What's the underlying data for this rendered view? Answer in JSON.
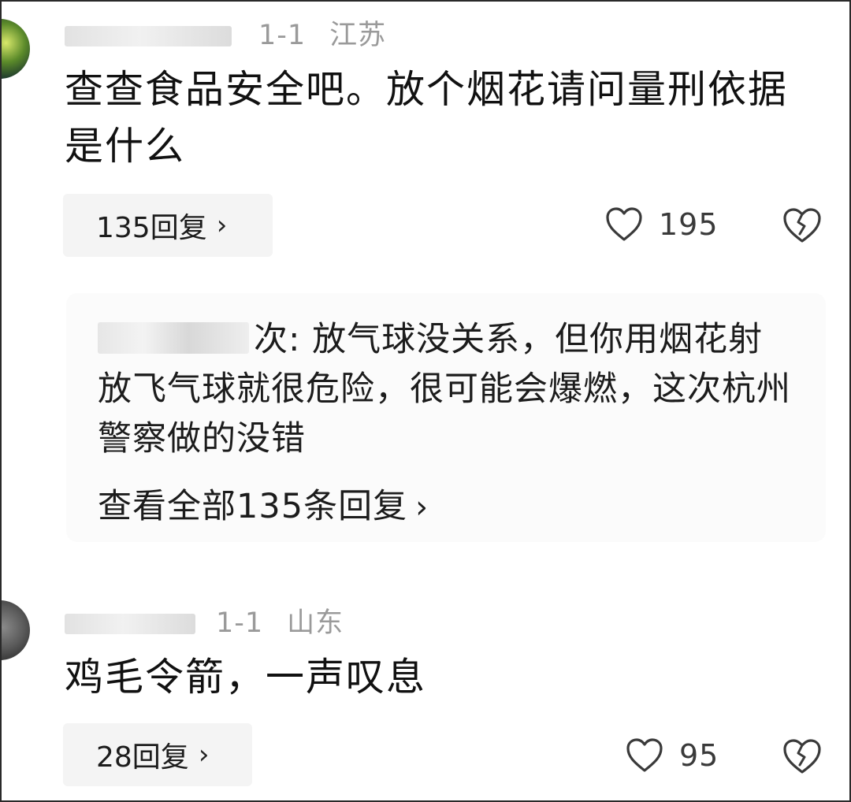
{
  "comments": [
    {
      "username": "",
      "date": "1-1",
      "location": "江苏",
      "text": "查查食品安全吧。放个烟花请问量刑依据是什么",
      "reply_button": "135回复",
      "likes": "195",
      "reply_preview": {
        "username": "",
        "separator": "次:",
        "text": " 放气球没关系，但你用烟花射放飞气球就很危险，很可能会爆燃，这次杭州警察做的没错",
        "view_all": "查看全部135条回复"
      }
    },
    {
      "username": "",
      "date": "1-1",
      "location": "山东",
      "text": "鸡毛令箭，一声叹息",
      "reply_button": "28回复",
      "likes": "95"
    }
  ],
  "icons": {
    "like": "heart-outline-icon",
    "dislike": "broken-heart-icon",
    "chevron": "chevron-right-icon"
  },
  "colors": {
    "meta_text": "#9a9a9a",
    "reply_button_bg": "#f4f4f4",
    "preview_bg": "#fbfbfb"
  },
  "chevron_glyph": "›"
}
